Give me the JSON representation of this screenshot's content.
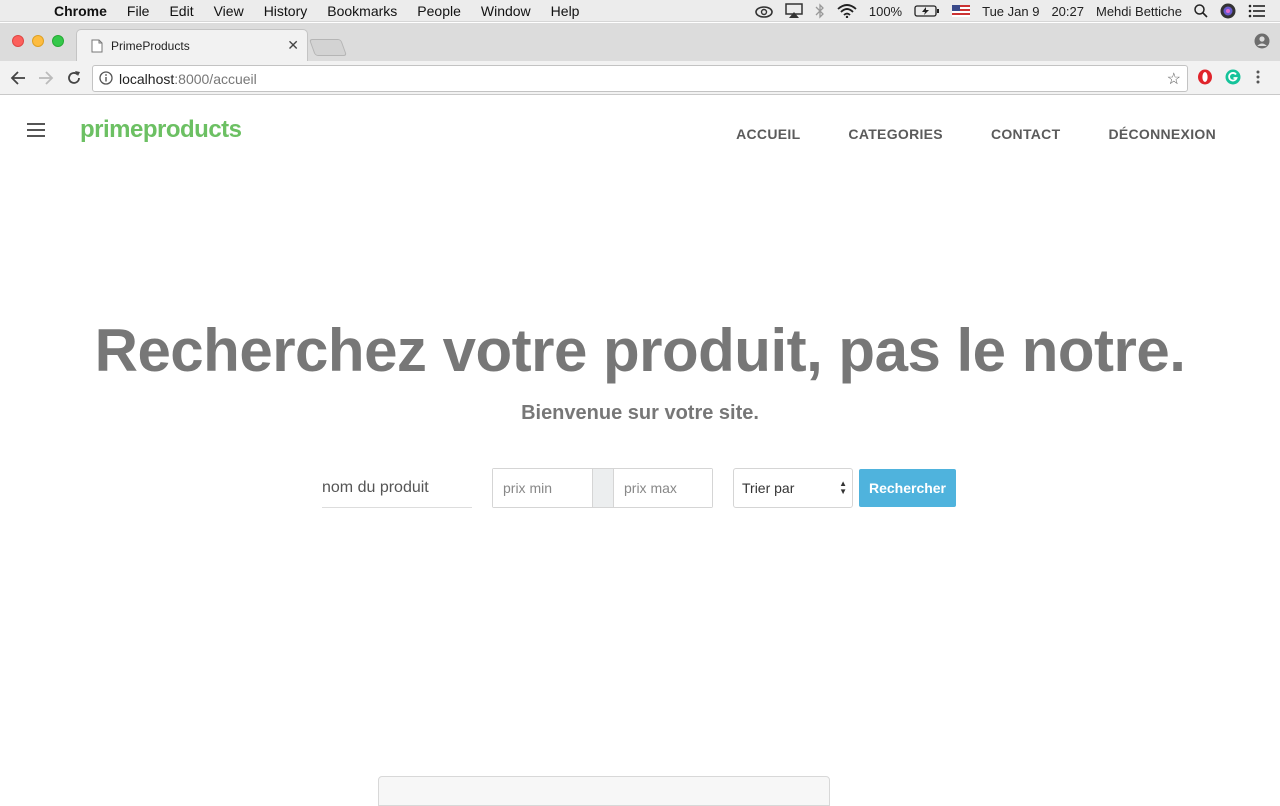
{
  "menubar": {
    "app_name": "Chrome",
    "items": [
      "File",
      "Edit",
      "View",
      "History",
      "Bookmarks",
      "People",
      "Window",
      "Help"
    ],
    "battery": "100%",
    "date": "Tue Jan 9",
    "time": "20:27",
    "user": "Mehdi Bettiche"
  },
  "browser": {
    "tab_title": "PrimeProducts",
    "url_host": "localhost",
    "url_rest": ":8000/accueil"
  },
  "site": {
    "brand": "primeproducts",
    "brand_color": "#6cc063",
    "nav": [
      "ACCUEIL",
      "CATEGORIES",
      "CONTACT",
      "DÉCONNEXION"
    ]
  },
  "hero": {
    "title": "Recherchez votre produit, pas le notre.",
    "subtitle": "Bienvenue sur votre site."
  },
  "search": {
    "product_placeholder": "nom du produit",
    "price_min_placeholder": "prix min",
    "price_max_placeholder": "prix max",
    "sort_label": "Trier par",
    "button_label": "Rechercher",
    "button_color": "#4fb3dd"
  }
}
